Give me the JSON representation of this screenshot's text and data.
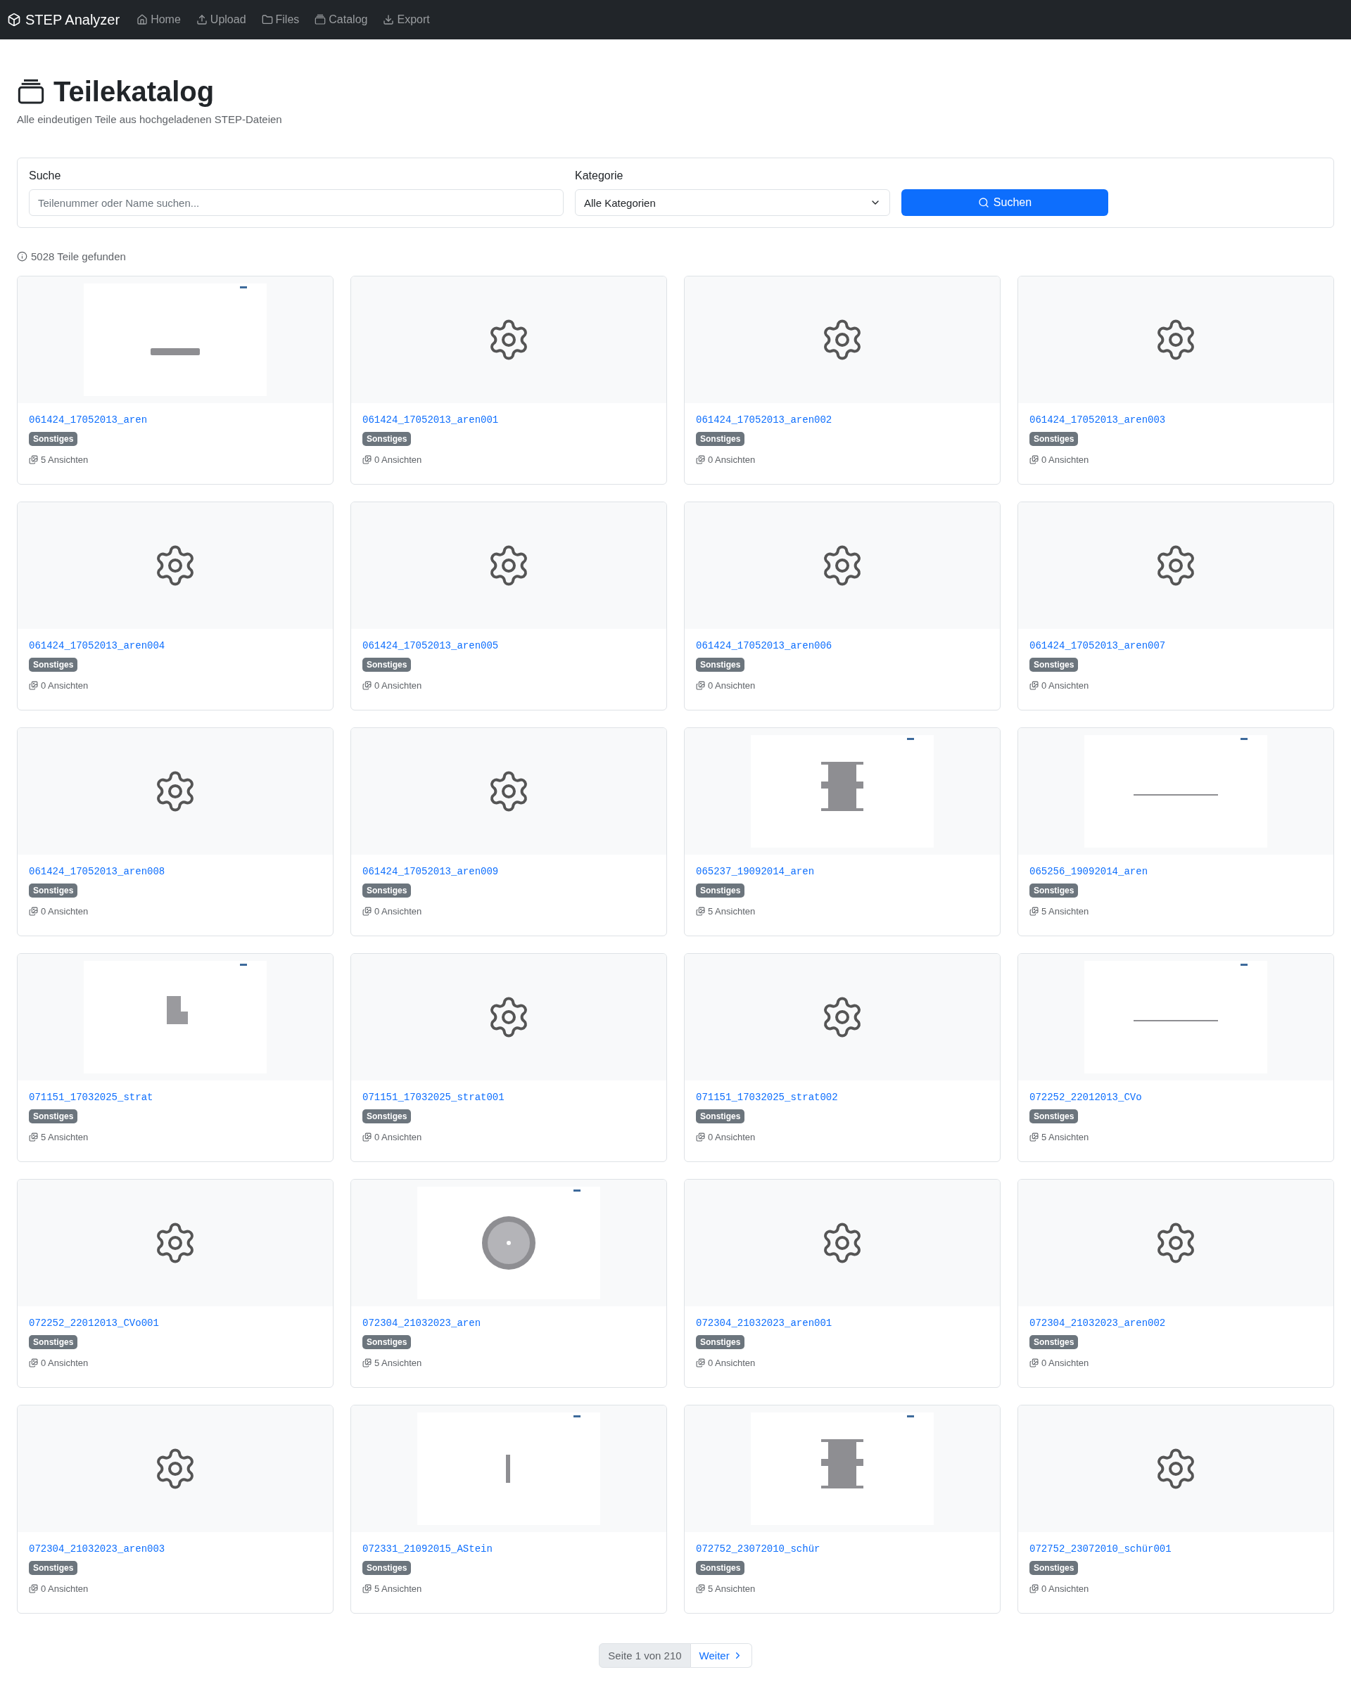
{
  "navbar": {
    "brand": "STEP Analyzer",
    "links": [
      {
        "label": "Home"
      },
      {
        "label": "Upload"
      },
      {
        "label": "Files"
      },
      {
        "label": "Catalog"
      },
      {
        "label": "Export"
      }
    ]
  },
  "header": {
    "title": "Teilekatalog",
    "subtitle": "Alle eindeutigen Teile aus hochgeladenen STEP-Dateien"
  },
  "search": {
    "search_label": "Suche",
    "placeholder": "Teilenummer oder Name suchen...",
    "category_label": "Kategorie",
    "category_value": "Alle Kategorien",
    "button": "Suchen"
  },
  "result_count": "5028 Teile gefunden",
  "parts": [
    {
      "name": "061424_17052013_aren",
      "category": "Sonstiges",
      "views": "5 Ansichten",
      "kind": "picture"
    },
    {
      "name": "061424_17052013_aren001",
      "category": "Sonstiges",
      "views": "0 Ansichten",
      "kind": "placeholder"
    },
    {
      "name": "061424_17052013_aren002",
      "category": "Sonstiges",
      "views": "0 Ansichten",
      "kind": "placeholder"
    },
    {
      "name": "061424_17052013_aren003",
      "category": "Sonstiges",
      "views": "0 Ansichten",
      "kind": "placeholder"
    },
    {
      "name": "061424_17052013_aren004",
      "category": "Sonstiges",
      "views": "0 Ansichten",
      "kind": "placeholder"
    },
    {
      "name": "061424_17052013_aren005",
      "category": "Sonstiges",
      "views": "0 Ansichten",
      "kind": "placeholder"
    },
    {
      "name": "061424_17052013_aren006",
      "category": "Sonstiges",
      "views": "0 Ansichten",
      "kind": "placeholder"
    },
    {
      "name": "061424_17052013_aren007",
      "category": "Sonstiges",
      "views": "0 Ansichten",
      "kind": "placeholder"
    },
    {
      "name": "061424_17052013_aren008",
      "category": "Sonstiges",
      "views": "0 Ansichten",
      "kind": "placeholder"
    },
    {
      "name": "061424_17052013_aren009",
      "category": "Sonstiges",
      "views": "0 Ansichten",
      "kind": "placeholder"
    },
    {
      "name": "065237_19092014_aren",
      "category": "Sonstiges",
      "views": "5 Ansichten",
      "kind": "picture"
    },
    {
      "name": "065256_19092014_aren",
      "category": "Sonstiges",
      "views": "5 Ansichten",
      "kind": "picture"
    },
    {
      "name": "071151_17032025_strat",
      "category": "Sonstiges",
      "views": "5 Ansichten",
      "kind": "picture"
    },
    {
      "name": "071151_17032025_strat001",
      "category": "Sonstiges",
      "views": "0 Ansichten",
      "kind": "placeholder"
    },
    {
      "name": "071151_17032025_strat002",
      "category": "Sonstiges",
      "views": "0 Ansichten",
      "kind": "placeholder"
    },
    {
      "name": "072252_22012013_CVo",
      "category": "Sonstiges",
      "views": "5 Ansichten",
      "kind": "picture"
    },
    {
      "name": "072252_22012013_CVo001",
      "category": "Sonstiges",
      "views": "0 Ansichten",
      "kind": "placeholder"
    },
    {
      "name": "072304_21032023_aren",
      "category": "Sonstiges",
      "views": "5 Ansichten",
      "kind": "picture"
    },
    {
      "name": "072304_21032023_aren001",
      "category": "Sonstiges",
      "views": "0 Ansichten",
      "kind": "placeholder"
    },
    {
      "name": "072304_21032023_aren002",
      "category": "Sonstiges",
      "views": "0 Ansichten",
      "kind": "placeholder"
    },
    {
      "name": "072304_21032023_aren003",
      "category": "Sonstiges",
      "views": "0 Ansichten",
      "kind": "placeholder"
    },
    {
      "name": "072331_21092015_AStein",
      "category": "Sonstiges",
      "views": "5 Ansichten",
      "kind": "picture"
    },
    {
      "name": "072752_23072010_schür",
      "category": "Sonstiges",
      "views": "5 Ansichten",
      "kind": "picture"
    },
    {
      "name": "072752_23072010_schür001",
      "category": "Sonstiges",
      "views": "0 Ansichten",
      "kind": "placeholder"
    }
  ],
  "pagination": {
    "page_info": "Seite 1 von 210",
    "next": "Weiter"
  }
}
